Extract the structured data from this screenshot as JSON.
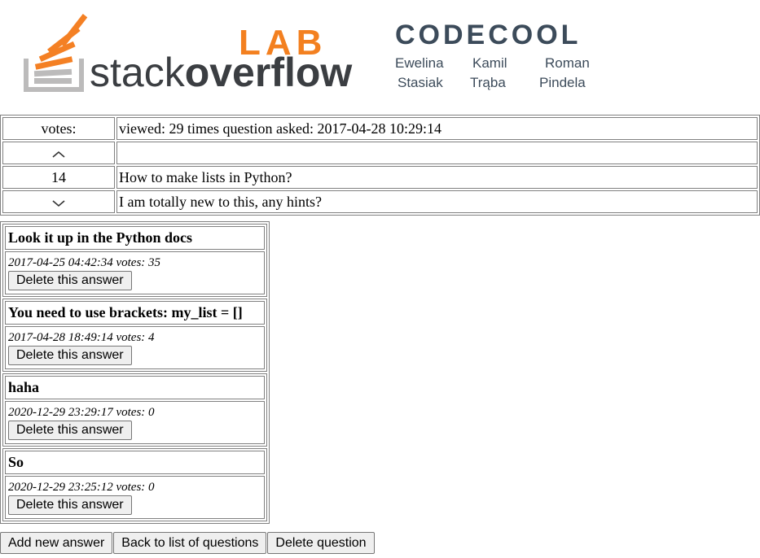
{
  "banner": {
    "lab_text": "LAB",
    "so_text_normal": "stack",
    "so_text_bold": "overflow",
    "codecool_text": "CODECOOL",
    "authors": [
      {
        "first": "Ewelina",
        "last": "Stasiak"
      },
      {
        "first": "Kamil",
        "last": "Trąba"
      },
      {
        "first": "Roman",
        "last": "Pindela"
      }
    ],
    "colors": {
      "orange": "#f48024",
      "lab_orange": "#f38020",
      "gray": "#3b3e42",
      "codecool_blue": "#3c4b5a"
    }
  },
  "question": {
    "votes_label": "votes:",
    "info": "viewed: 29 times question asked: 2017-04-28 10:29:14",
    "upvote_icon": "chevron-up-icon",
    "vote_count": "14",
    "title": "How to make lists in Python?",
    "downvote_icon": "chevron-down-icon",
    "message": "I am totally new to this, any hints?"
  },
  "answers": [
    {
      "message": "Look it up in the Python docs",
      "meta": "2017-04-25 04:42:34 votes: 35",
      "delete_label": "Delete this answer"
    },
    {
      "message": "You need to use brackets: my_list = []",
      "meta": "2017-04-28 18:49:14 votes: 4",
      "delete_label": "Delete this answer"
    },
    {
      "message": "haha",
      "meta": "2020-12-29 23:29:17 votes: 0",
      "delete_label": "Delete this answer"
    },
    {
      "message": "So",
      "meta": "2020-12-29 23:25:12 votes: 0",
      "delete_label": "Delete this answer"
    }
  ],
  "actions": {
    "add_answer": "Add new answer",
    "back": "Back to list of questions",
    "delete_question": "Delete question"
  }
}
